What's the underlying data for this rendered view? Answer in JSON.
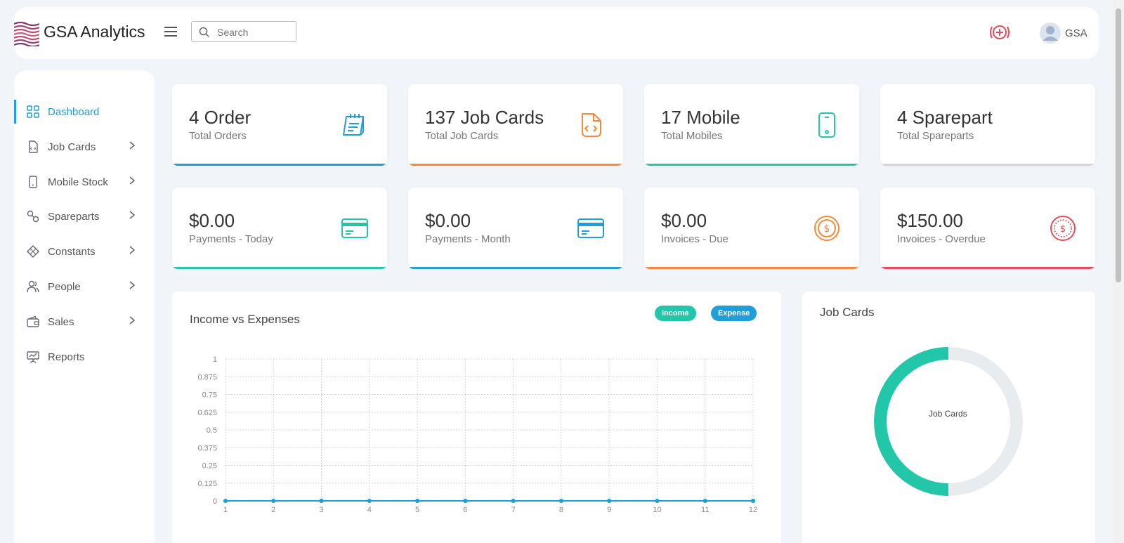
{
  "header": {
    "brand": "GSA Analytics",
    "search_placeholder": "Search",
    "user_name": "GSA",
    "accent_color": "#e84c5a"
  },
  "sidebar": {
    "items": [
      {
        "label": "Dashboard",
        "icon": "grid-icon",
        "has_submenu": false
      },
      {
        "label": "Job Cards",
        "icon": "job-card-icon",
        "has_submenu": true
      },
      {
        "label": "Mobile Stock",
        "icon": "mobile-icon",
        "has_submenu": true
      },
      {
        "label": "Spareparts",
        "icon": "spareparts-icon",
        "has_submenu": true
      },
      {
        "label": "Constants",
        "icon": "constants-icon",
        "has_submenu": true
      },
      {
        "label": "People",
        "icon": "people-icon",
        "has_submenu": true
      },
      {
        "label": "Sales",
        "icon": "wallet-icon",
        "has_submenu": true
      },
      {
        "label": "Reports",
        "icon": "presentation-icon",
        "has_submenu": false
      }
    ],
    "active": "Dashboard",
    "active_color": "#1f9ed8"
  },
  "stats": [
    {
      "value": "4 Order",
      "label": "Total Orders",
      "icon": "order-note-icon",
      "color": "#1f9ed8"
    },
    {
      "value": "137 Job Cards",
      "label": "Total Job Cards",
      "icon": "code-file-icon",
      "color": "#f58a3d"
    },
    {
      "value": "17 Mobile",
      "label": "Total Mobiles",
      "icon": "mobile-icon",
      "color": "#22c7a9"
    },
    {
      "value": "4 Sparepart",
      "label": "Total Spareparts",
      "icon": "",
      "color": "#d6d6d6"
    },
    {
      "value": "$0.00",
      "label": "Payments - Today",
      "icon": "credit-card-icon",
      "color": "#22c7a9"
    },
    {
      "value": "$0.00",
      "label": "Payments - Month",
      "icon": "credit-card-icon",
      "color": "#1f9ed8"
    },
    {
      "value": "$0.00",
      "label": "Invoices - Due",
      "icon": "dollar-coin-icon",
      "color": "#f58a3d"
    },
    {
      "value": "$150.00",
      "label": "Invoices - Overdue",
      "icon": "dollar-dashed-icon",
      "color": "#e84c5a"
    }
  ],
  "income_chart": {
    "title": "Income vs Expenses",
    "legend": [
      {
        "label": "Income",
        "color": "#22c7a9"
      },
      {
        "label": "Expense",
        "color": "#1f9ed8"
      }
    ]
  },
  "job_cards_panel": {
    "title": "Job Cards",
    "center_label": "Job Cards"
  },
  "chart_data": [
    {
      "type": "line",
      "title": "Income vs Expenses",
      "x": [
        1,
        2,
        3,
        4,
        5,
        6,
        7,
        8,
        9,
        10,
        11,
        12
      ],
      "series": [
        {
          "name": "Income",
          "values": [
            0,
            0,
            0,
            0,
            0,
            0,
            0,
            0,
            0,
            0,
            0,
            0
          ],
          "color": "#22c7a9"
        },
        {
          "name": "Expense",
          "values": [
            0,
            0,
            0,
            0,
            0,
            0,
            0,
            0,
            0,
            0,
            0,
            0
          ],
          "color": "#1f9ed8"
        }
      ],
      "ylim": [
        0,
        1
      ],
      "yticks": [
        "0",
        "0.125",
        "0.25",
        "0.375",
        "0.5",
        "0.625",
        "0.75",
        "0.875",
        "1"
      ],
      "grid": true,
      "legend_position": "top-right"
    },
    {
      "type": "pie",
      "title": "Job Cards",
      "center_label": "Job Cards",
      "slices": [
        {
          "value": 0.5,
          "color": "#22c7a9"
        },
        {
          "value": 0.5,
          "color": "#e9ecee"
        }
      ]
    }
  ]
}
